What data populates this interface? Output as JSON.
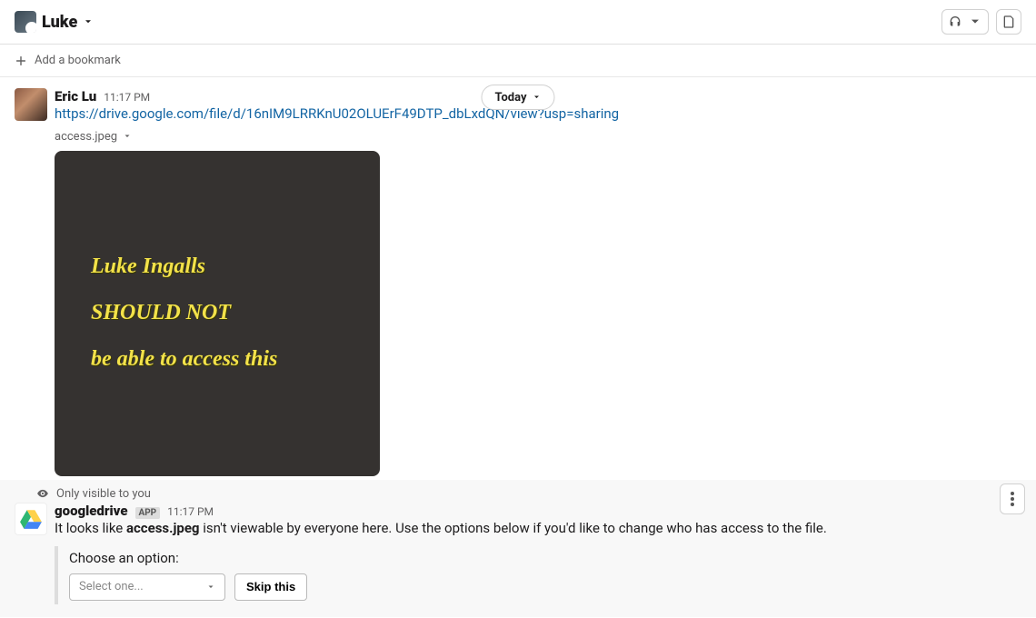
{
  "header": {
    "channel_name": "Luke"
  },
  "bookmark_bar": {
    "add_bookmark_label": "Add a bookmark"
  },
  "date_divider": {
    "label": "Today"
  },
  "messages": {
    "first": {
      "author": "Eric Lu",
      "timestamp": "11:17 PM",
      "link_text": "https://drive.google.com/file/d/16nIM9LRRKnU02OLUErF49DTP_dbLxdQN/view?usp=sharing",
      "file_label": "access.jpeg",
      "image_text": {
        "line1": "Luke Ingalls",
        "line2": "SHOULD NOT",
        "line3": "be able to access this"
      }
    },
    "ephemeral": {
      "only_visible_label": "Only visible to you",
      "author": "googledrive",
      "app_badge": "APP",
      "timestamp": "11:17 PM",
      "body_prefix": "It looks like ",
      "body_filename": "access.jpeg",
      "body_suffix": " isn't viewable by everyone here. Use the options below if you'd like to change who has access to the file.",
      "attachment": {
        "prompt": "Choose an option:",
        "select_placeholder": "Select one...",
        "skip_label": "Skip this"
      }
    }
  }
}
